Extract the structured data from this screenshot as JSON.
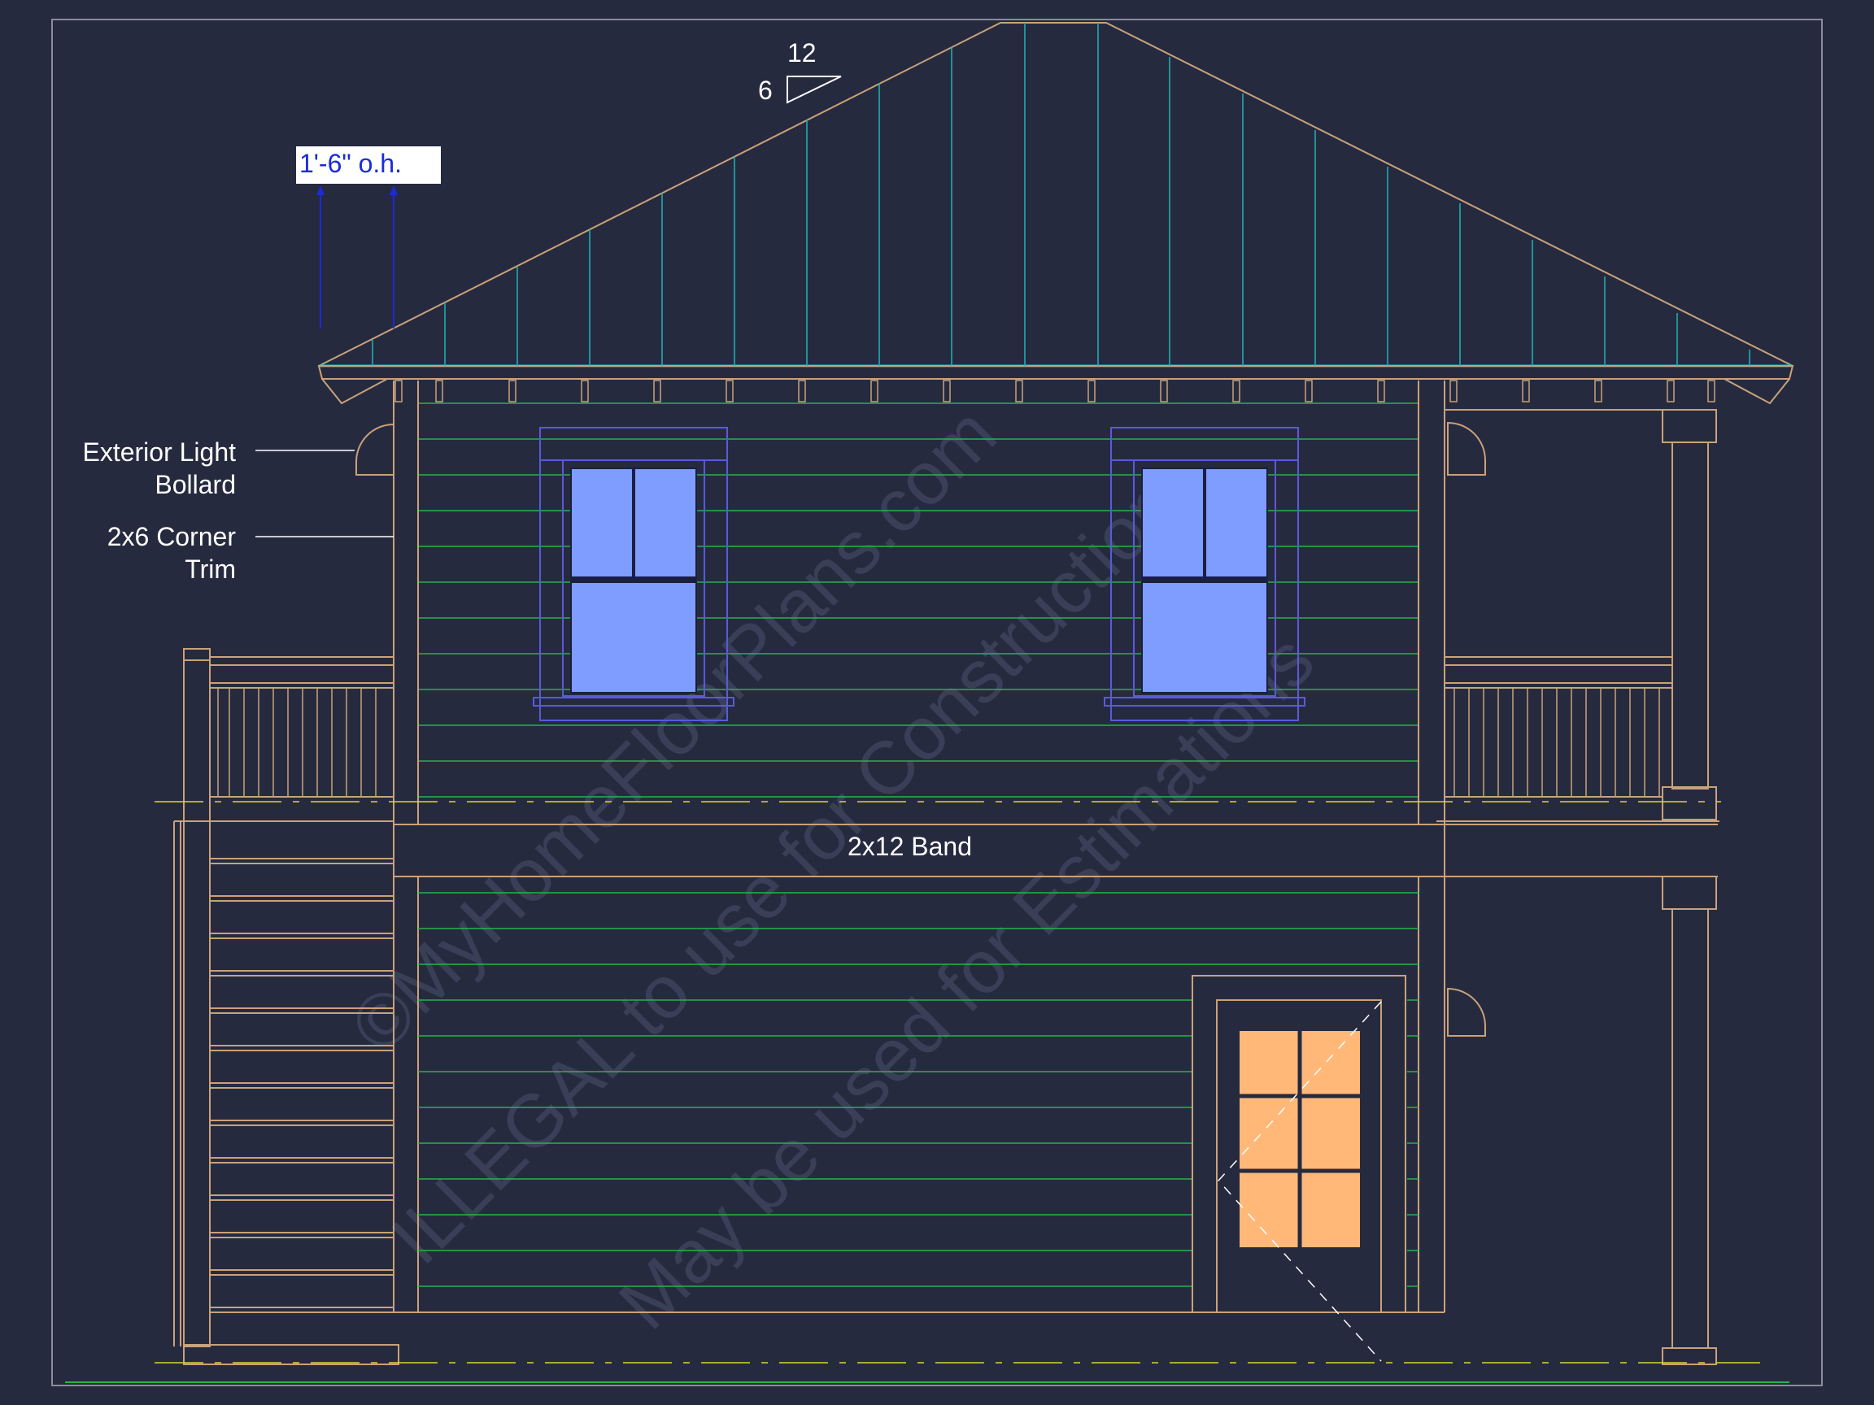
{
  "roof": {
    "pitch_rise": "6",
    "pitch_run": "12"
  },
  "dimension": {
    "overhang": "1'-6\" o.h."
  },
  "callouts": {
    "light_line1": "Exterior Light",
    "light_line2": "Bollard",
    "trim_line1": "2x6 Corner",
    "trim_line2": "Trim"
  },
  "band_label": "2x12 Band",
  "watermark": {
    "line1": "©MyHomeFloorPlans.com",
    "line2": "ILLEGAL to use for Construction",
    "line3": "May be used for Estimations"
  },
  "colors": {
    "background": "#262a3f",
    "outline": "#c9a27a",
    "siding": "#26b34a",
    "roof_lines": "#1fb5b5",
    "window_glass": "#7f9cff",
    "door_glass": "#ffb878",
    "dimension": "#1b2bd8"
  }
}
